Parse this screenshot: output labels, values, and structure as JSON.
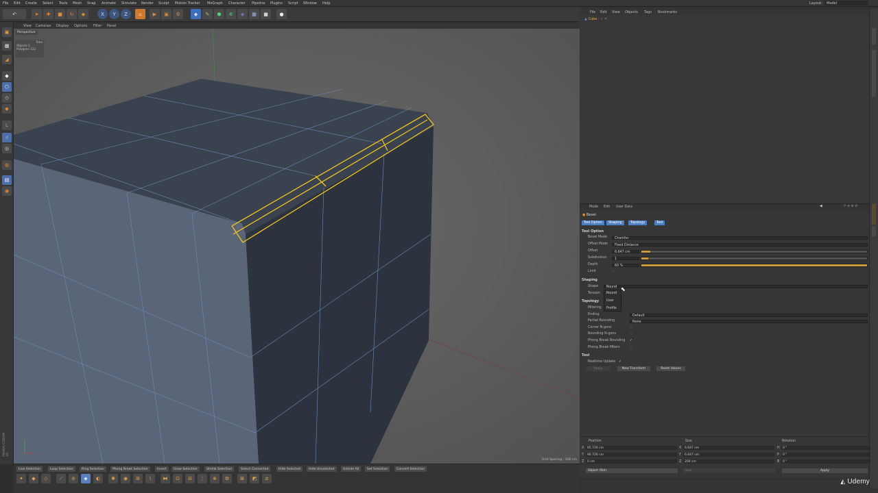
{
  "menubar": {
    "items": [
      "File",
      "Edit",
      "Create",
      "Select",
      "Tools",
      "Mesh",
      "Snap",
      "Animate",
      "Simulate",
      "Render",
      "Sculpt",
      "Motion Tracker",
      "MoGraph",
      "Character",
      "Pipeline",
      "Plugins",
      "Script",
      "Window",
      "Help"
    ],
    "layout_label": "Layout:",
    "layout_value": "Model"
  },
  "toolbar": {
    "x": "X",
    "y": "Y",
    "z": "Z"
  },
  "viewport": {
    "menu": [
      "View",
      "Cameras",
      "Display",
      "Options",
      "Filter",
      "Panel"
    ],
    "camera": "Perspective",
    "stats": {
      "header": "Total",
      "objects_label": "Objects",
      "objects": "1",
      "polygons_label": "Polygons",
      "polygons": "122"
    },
    "grid_spacing": "Grid Spacing : 100 cm"
  },
  "object_manager": {
    "menu": [
      "File",
      "Edit",
      "View",
      "Objects",
      "Tags",
      "Bookmarks"
    ],
    "object": "Cube"
  },
  "attributes": {
    "menu": [
      "Mode",
      "Edit",
      "User Data"
    ],
    "tool_name": "Bevel",
    "tabs": [
      "Tool Option",
      "Shaping",
      "Topology",
      "Tool"
    ],
    "tool_option": {
      "title": "Tool Option",
      "bevel_mode_label": "Bevel Mode",
      "bevel_mode": "Chamfer",
      "offset_mode_label": "Offset Mode",
      "offset_mode": "Fixed Distance",
      "offset_label": "Offset",
      "offset": "6.647 cm",
      "offset_frac": 0.04,
      "subdivision_label": "Subdivision",
      "subdivision": "1",
      "subdivision_frac": 0.03,
      "depth_label": "Depth",
      "depth": "60 %",
      "depth_frac": 1.0,
      "limit_label": "Limit"
    },
    "shaping": {
      "title": "Shaping",
      "shape_label": "Shape",
      "shape": "Round",
      "tension_label": "Tension",
      "dropdown_options": [
        "Round",
        "User",
        "Profile"
      ]
    },
    "topology": {
      "title": "Topology",
      "mitering_label": "Mitering",
      "ending_label": "Ending",
      "ending": "Default",
      "partial_label": "Partial Rounding",
      "partial": "None",
      "corner_ngons": "Corner N-gons",
      "rounding_ngons": "Rounding N-gons",
      "phong_rounding": "Phong Break Rounding",
      "phong_miters": "Phong Break Miters"
    },
    "tool": {
      "title": "Tool",
      "realtime_label": "Realtime Update",
      "apply": "Apply",
      "new_transform": "New Transform",
      "reset_values": "Reset Values"
    }
  },
  "coordinates": {
    "position_label": "Position",
    "size_label": "Size",
    "rotation_label": "Rotation",
    "rows": [
      {
        "axis": "X",
        "pos": "85.726 cm",
        "size": "6.647 cm",
        "rlabel": "H",
        "rot": "0 °"
      },
      {
        "axis": "Y",
        "pos": "96.726 cm",
        "size": "6.647 cm",
        "rlabel": "P",
        "rot": "0 °"
      },
      {
        "axis": "Z",
        "pos": "0 cm",
        "size": "200 cm",
        "rlabel": "B",
        "rot": "0 °"
      }
    ],
    "mode": "Object (Rel)",
    "size_mode": "Size",
    "apply": "Apply"
  },
  "bottom": {
    "selections": [
      "Live Selection",
      "Loop Selection",
      "Ring Selection",
      "Phong Break Selection",
      "Invert",
      "Grow Selection",
      "Shrink Selection",
      "Select Connected",
      "Hide Selected",
      "Hide Unselected",
      "Unhide All",
      "Set Selection",
      "Convert Selection"
    ]
  },
  "watermark": "Udemy",
  "brand": "MAXON CINEMA 4D",
  "colors": {
    "accent": "#d1782a",
    "select": "#f5c518",
    "tab": "#4c7fc4"
  }
}
